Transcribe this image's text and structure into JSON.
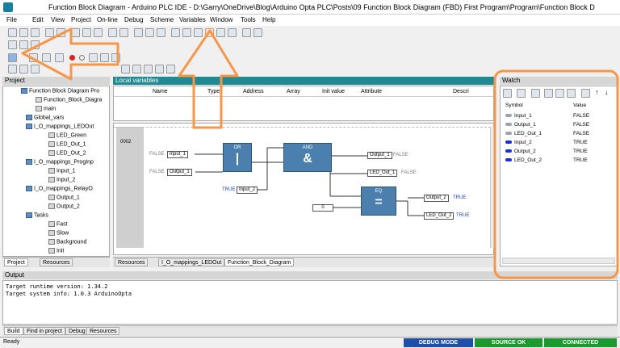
{
  "window": {
    "title": "Function Block Diagram - Arduino PLC IDE - D:\\Garry\\OneDrive\\Blog\\Arduino Opta PLC\\Posts\\09 Function Block Diagram (FBD) First Program\\Program\\Function Block D"
  },
  "menu": [
    "File",
    "Edit",
    "View",
    "Project",
    "On-line",
    "Debug",
    "Scheme",
    "Variables",
    "Window",
    "Tools",
    "Help"
  ],
  "project_panel": {
    "title": "Project",
    "tree": [
      "Function Block Diagram Pro",
      "Function_Block_Diagra",
      "main",
      "Global_vars",
      "I_O_mappings_LEDOut",
      "LED_Green",
      "LED_Out_1",
      "LED_Out_2",
      "I_O_mappings_ProgInp",
      "Input_1",
      "Input_2",
      "I_O_mappings_RelayO",
      "Output_1",
      "Output_2",
      "Tasks",
      "Fast",
      "Slow",
      "Background",
      "Init"
    ],
    "tabs": [
      "Project",
      "Resources"
    ]
  },
  "local_vars": {
    "title": "Local variables",
    "columns": [
      "Name",
      "Type",
      "Address",
      "Array",
      "Init value",
      "Attribute",
      "Descri"
    ]
  },
  "fbd": {
    "network_number": "0002",
    "blocks": {
      "or": {
        "title": "OR",
        "symbol": "|"
      },
      "and": {
        "title": "AND",
        "symbol": "&"
      },
      "eq": {
        "title": "EQ",
        "symbol": "="
      }
    },
    "vars": {
      "input_1": "Input_1",
      "output_1_in": "Output_1",
      "input_2": "Input_2",
      "output_1_out": "Output_1",
      "led_out_1": "LED_Out_1",
      "output_2": "Output_2",
      "led_out_2": "LED_Out_2",
      "const_0": "0"
    },
    "values": {
      "input_1": "FALSE",
      "output_1_in": "FALSE",
      "input_2": "TRUE",
      "output_1_out": "FALSE",
      "led_out_1": "FALSE",
      "output_2": "TRUE",
      "led_out_2": "TRUE"
    }
  },
  "editor_tabs": [
    "Resources",
    "I_O_mappings_LEDOut",
    "Function_Block_Diagram"
  ],
  "watch": {
    "title": "Watch",
    "col_symbol": "Symbol",
    "col_value": "Value",
    "rows": [
      {
        "symbol": "Input_1",
        "value": "FALSE",
        "color": "#9aa4b0"
      },
      {
        "symbol": "Output_1",
        "value": "FALSE",
        "color": "#9aa4b0"
      },
      {
        "symbol": "LED_Out_1",
        "value": "FALSE",
        "color": "#9aa4b0"
      },
      {
        "symbol": "Input_2",
        "value": "TRUE",
        "color": "#1c2fd6"
      },
      {
        "symbol": "Output_2",
        "value": "TRUE",
        "color": "#1c2fd6"
      },
      {
        "symbol": "LED_Out_2",
        "value": "TRUE",
        "color": "#1c2fd6"
      }
    ]
  },
  "output": {
    "title": "Output",
    "lines": [
      "Target runtime version: 1.34.2",
      "Target system info: 1.0.3 ArduinoOpta"
    ],
    "tabs": [
      "Build",
      "Find in project",
      "Debug",
      "Resources"
    ]
  },
  "status": {
    "left": "Ready",
    "debug": "DEBUG MODE",
    "source": "SOURCE OK",
    "connected": "CONNECTED"
  },
  "colors": {
    "accent_orange": "#f79647",
    "panel_teal": "#1e8a94",
    "status_blue": "#1f4fa8",
    "status_green": "#1a9a2e"
  }
}
